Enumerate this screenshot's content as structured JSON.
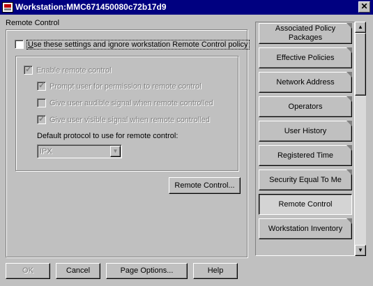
{
  "window": {
    "title": "Workstation:MMC671450080c72b17d9",
    "close_glyph": "✕"
  },
  "page": {
    "section_label": "Remote Control",
    "use_settings_label": "Use these settings and ignore workstation Remote Control policy",
    "enable_remote_label": "Enable remote control",
    "prompt_label": "Prompt user for permission to remote control",
    "audible_label": "Give user audible signal when remote controlled",
    "visible_label": "Give user visible signal when remote controlled",
    "protocol_label": "Default protocol to use for remote control:",
    "protocol_value": "IPX",
    "remote_control_button": "Remote Control..."
  },
  "checkboxes": {
    "use_settings": false,
    "enable_remote": true,
    "prompt": true,
    "audible": false,
    "visible": true
  },
  "tabs": [
    {
      "label": "Associated Policy Packages",
      "active": false
    },
    {
      "label": "Effective Policies",
      "active": false
    },
    {
      "label": "Network Address",
      "active": false
    },
    {
      "label": "Operators",
      "active": false
    },
    {
      "label": "User History",
      "active": false
    },
    {
      "label": "Registered Time",
      "active": false
    },
    {
      "label": "Security Equal To Me",
      "active": false
    },
    {
      "label": "Remote Control",
      "active": true
    },
    {
      "label": "Workstation Inventory",
      "active": false
    }
  ],
  "buttons": {
    "ok": "OK",
    "cancel": "Cancel",
    "page_options": "Page Options...",
    "help": "Help"
  },
  "icons": {
    "window_icon": "workstation-icon",
    "scroll_up": "▲",
    "scroll_down": "▼",
    "dropdown": "▼"
  }
}
